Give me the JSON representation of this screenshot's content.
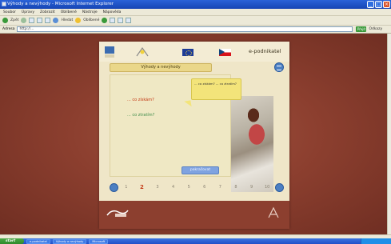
{
  "window": {
    "title": "Výhody a nevýhody - Microsoft Internet Explorer"
  },
  "menu": {
    "items": [
      "Soubor",
      "Úpravy",
      "Zobrazit",
      "Oblíbené",
      "Nástroje",
      "Nápověda"
    ]
  },
  "toolbar": {
    "back_label": "Zpět",
    "search_label": "Hledat",
    "favorites_label": "Oblíbené"
  },
  "address": {
    "label": "Adresa",
    "value": "http://...",
    "go_label": "Přejít",
    "links_label": "Odkazy"
  },
  "module": {
    "brand": "e-podnikatel",
    "section_title": "Výhody a nevýhody",
    "link_1": "... co získám?",
    "link_2": "... co ztratím?",
    "callout_text": "... co získám? ... co ztratím?",
    "forward_button": "pokračovat",
    "pages": [
      "1",
      "2",
      "3",
      "4",
      "5",
      "6",
      "7",
      "8",
      "9",
      "10"
    ],
    "active_page": "2",
    "footer_text": ""
  },
  "status": {
    "text": ""
  },
  "taskbar": {
    "start_label": "start",
    "tasks": [
      "e-podnikatel",
      "Výhody a nevýhody",
      "Microsoft"
    ],
    "clock": ""
  },
  "colors": {
    "background": "#8c3f2f",
    "panel": "#efe6c8",
    "accent_blue": "#4b7fc2",
    "callout": "#f3e47a",
    "link_red": "#c43a16",
    "link_green": "#3e8c4a"
  }
}
